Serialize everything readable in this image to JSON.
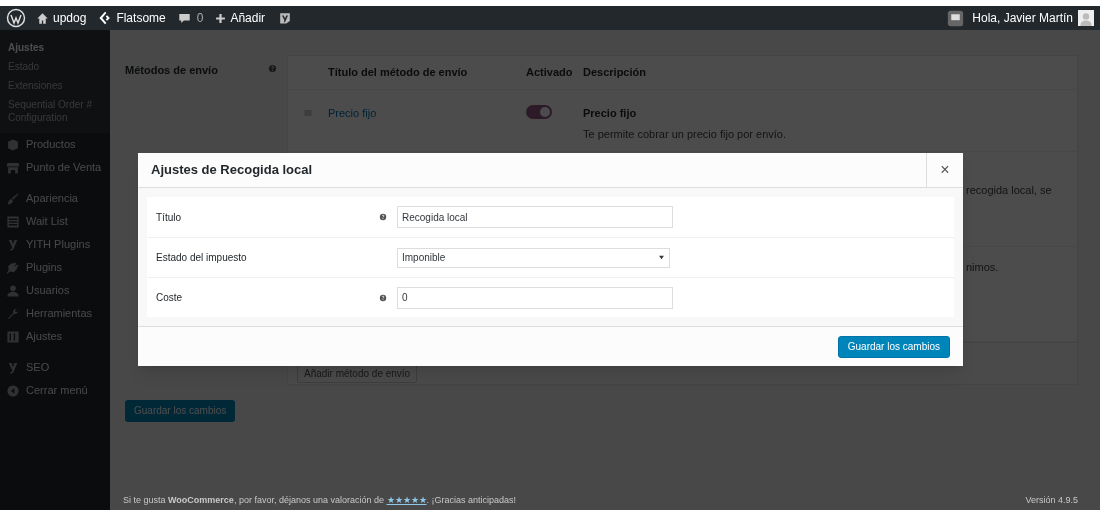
{
  "admin_bar": {
    "site": "updog",
    "theme": "Flatsome",
    "comments": "0",
    "new": "Añadir",
    "greeting": "Hola, Javier Martín"
  },
  "sidebar": {
    "submenu": [
      {
        "label": "Ajustes",
        "selected": true
      },
      {
        "label": "Estado",
        "selected": false
      },
      {
        "label": "Extensiones",
        "selected": false
      },
      {
        "label": "Sequential Order # Configuration",
        "selected": false
      }
    ],
    "groups": [
      [
        "Productos",
        "Punto de Venta"
      ],
      [
        "Apariencia",
        "Wait List",
        "YITH Plugins",
        "Plugins",
        "Usuarios",
        "Herramientas",
        "Ajustes"
      ],
      [
        "SEO",
        "Cerrar menú"
      ]
    ]
  },
  "shipping": {
    "label": "Métodos de envío",
    "columns": [
      "Título del método de envío",
      "Activado",
      "Descripción"
    ],
    "rows": [
      {
        "kind": "method",
        "title": "Precio fijo",
        "enabled": true,
        "description_title": "Precio fijo",
        "description": "Te permite cobrar un precio fijo por envío."
      },
      {
        "kind": "obscured",
        "description": "recogida local, se"
      },
      {
        "kind": "obscured",
        "description": "nimos."
      }
    ],
    "add_button": "Añadir método de envío"
  },
  "save_button": "Guardar los cambios",
  "modal": {
    "title": "Ajustes de Recogida local",
    "close": "×",
    "fields": [
      {
        "label": "Título",
        "kind": "text",
        "help": true,
        "value": "Recogida local"
      },
      {
        "label": "Estado del impuesto",
        "kind": "select",
        "help": false,
        "value": "Imponible"
      },
      {
        "label": "Coste",
        "kind": "text",
        "help": true,
        "value": "0"
      }
    ],
    "save_button": "Guardar los cambios"
  },
  "footer": {
    "before": "Si te gusta **WooCommerce**, por favor, déjanos una valoración de",
    "link": "★★★★★",
    "after": ". ¡Gracias anticipadas!",
    "version": "Versión 4.9.5"
  }
}
